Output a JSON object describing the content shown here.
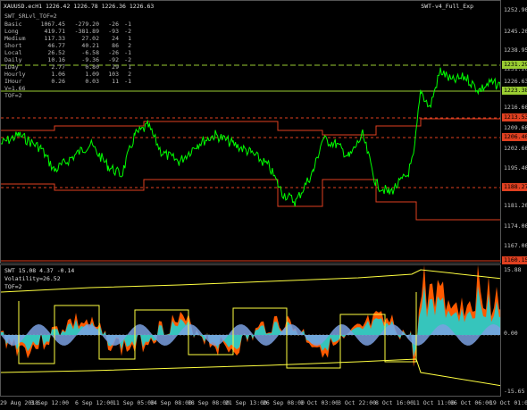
{
  "chart": {
    "title": "XAUUSD.ecH1  1226.42 1226.78 1226.36 1226.63",
    "expert_label": "SWT-v4_Full_Exp",
    "indicator_name": "SWT_SRLvl_TOF=2"
  },
  "info_table": [
    {
      "name": "Basic",
      "a": "1067.45",
      "b": "-279.20",
      "c": "-26",
      "d": "-1"
    },
    {
      "name": "Long",
      "a": "419.71",
      "b": "-381.89",
      "c": "-93",
      "d": "-2"
    },
    {
      "name": "Medium",
      "a": "117.33",
      "b": "27.02",
      "c": "24",
      "d": "1"
    },
    {
      "name": "Short",
      "a": "46.77",
      "b": "40.21",
      "c": "86",
      "d": "2"
    },
    {
      "name": "Local",
      "a": "26.52",
      "b": "-6.58",
      "c": "-26",
      "d": "-1"
    },
    {
      "name": "Daily",
      "a": "10.16",
      "b": "-9.36",
      "c": "-92",
      "d": "-2"
    },
    {
      "name": "IDay",
      "a": "2.77",
      "b": "0.80",
      "c": "29",
      "d": "1"
    },
    {
      "name": "Hourly",
      "a": "1.06",
      "b": "1.09",
      "c": "103",
      "d": "2"
    },
    {
      "name": "IHour",
      "a": "0.26",
      "b": "0.03",
      "c": "11",
      "d": "-1"
    }
  ],
  "extra_lines": [
    "V=1.66",
    "TOF=2"
  ],
  "price_axis": {
    "ticks": [
      "1252.90",
      "1245.20",
      "1238.95",
      "1231.20",
      "1226.63",
      "1216.60",
      "1209.60",
      "1202.60",
      "1195.40",
      "1188.15",
      "1181.20",
      "1174.00",
      "1167.00",
      "1160.15"
    ],
    "tags": [
      {
        "label": "1231.29",
        "color": "#9acd32"
      },
      {
        "label": "1223.38",
        "color": "#9acd32"
      },
      {
        "label": "1213.53",
        "color": "#e04020"
      },
      {
        "label": "1206.40",
        "color": "#e04020"
      },
      {
        "label": "1188.27",
        "color": "#e04020"
      },
      {
        "label": "1160.15",
        "color": "#e04020"
      }
    ]
  },
  "indicator": {
    "header": "SWT 15.08 4.37 -0.14",
    "volatility": "Volatility=26.52",
    "tof": "TOF=2",
    "axis_top": "15.88",
    "axis_mid": "0.00",
    "axis_bottom": "-15.65"
  },
  "time_axis": [
    "29 Aug 2018",
    "3 Sep 12:00",
    "6 Sep 12:00",
    "11 Sep 05:00",
    "14 Sep 08:00",
    "18 Sep 08:00",
    "21 Sep 13:00",
    "26 Sep 08:00",
    "1 Oct 03:00",
    "3 Oct 22:00",
    "8 Oct 16:00",
    "11 Oct 11:00",
    "16 Oct 06:00",
    "19 Oct 01:00"
  ],
  "colors": {
    "price_line": "#00ff00",
    "level_green": "#9acd32",
    "level_red": "#e04020",
    "bands": "#ffff40",
    "osc_orange": "#ff5a00",
    "osc_cyan": "#20d0d0",
    "osc_blue": "#7aa0e0"
  }
}
